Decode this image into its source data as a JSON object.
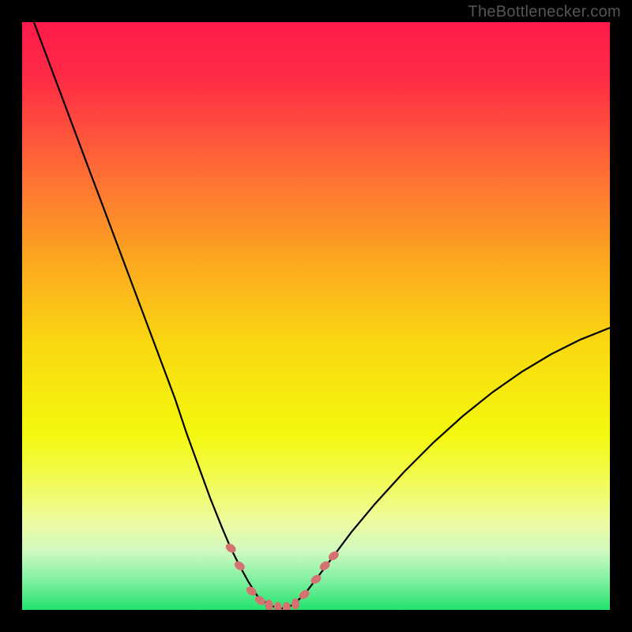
{
  "watermark": "TheBottlenecker.com",
  "chart_data": {
    "type": "line",
    "title": "",
    "xlabel": "",
    "ylabel": "",
    "xlim": [
      0,
      100
    ],
    "ylim": [
      0,
      100
    ],
    "grid": false,
    "background_gradient": {
      "stops": [
        {
          "offset": 0.0,
          "color": "#ff1a4b"
        },
        {
          "offset": 0.1,
          "color": "#ff2d45"
        },
        {
          "offset": 0.25,
          "color": "#fe6b36"
        },
        {
          "offset": 0.4,
          "color": "#fca520"
        },
        {
          "offset": 0.55,
          "color": "#f9d910"
        },
        {
          "offset": 0.7,
          "color": "#f4f80e"
        },
        {
          "offset": 0.78,
          "color": "#f2fb55"
        },
        {
          "offset": 0.85,
          "color": "#edfba0"
        },
        {
          "offset": 0.9,
          "color": "#d0f9c0"
        },
        {
          "offset": 0.95,
          "color": "#7ff0a0"
        },
        {
          "offset": 1.0,
          "color": "#23e36c"
        }
      ]
    },
    "series": [
      {
        "name": "bottleneck-curve",
        "x": [
          2,
          5,
          8,
          11,
          14,
          17,
          20,
          23,
          26,
          28,
          30,
          32,
          34,
          35.5,
          37,
          38.5,
          40,
          42,
          44,
          46,
          48,
          50,
          53,
          56,
          60,
          65,
          70,
          75,
          80,
          85,
          90,
          95,
          100
        ],
        "y": [
          100,
          92,
          84,
          76,
          68,
          60,
          52,
          44,
          36,
          30,
          24.5,
          19,
          14,
          10.5,
          7.5,
          4.8,
          2.4,
          0.8,
          0.2,
          0.8,
          2.6,
          5.2,
          9.2,
          13.2,
          18,
          23.5,
          28.5,
          33,
          37,
          40.5,
          43.5,
          46,
          48
        ]
      }
    ],
    "markers": {
      "name": "data-points",
      "color": "#d47272",
      "points": [
        {
          "x": 35.5,
          "y": 10.5
        },
        {
          "x": 37.0,
          "y": 7.5
        },
        {
          "x": 39.0,
          "y": 3.2
        },
        {
          "x": 40.5,
          "y": 1.6
        },
        {
          "x": 42.0,
          "y": 0.8
        },
        {
          "x": 43.5,
          "y": 0.4
        },
        {
          "x": 45.0,
          "y": 0.4
        },
        {
          "x": 46.5,
          "y": 1.0
        },
        {
          "x": 48.0,
          "y": 2.6
        },
        {
          "x": 50.0,
          "y": 5.2
        },
        {
          "x": 51.5,
          "y": 7.5
        },
        {
          "x": 53.0,
          "y": 9.2
        }
      ]
    }
  }
}
